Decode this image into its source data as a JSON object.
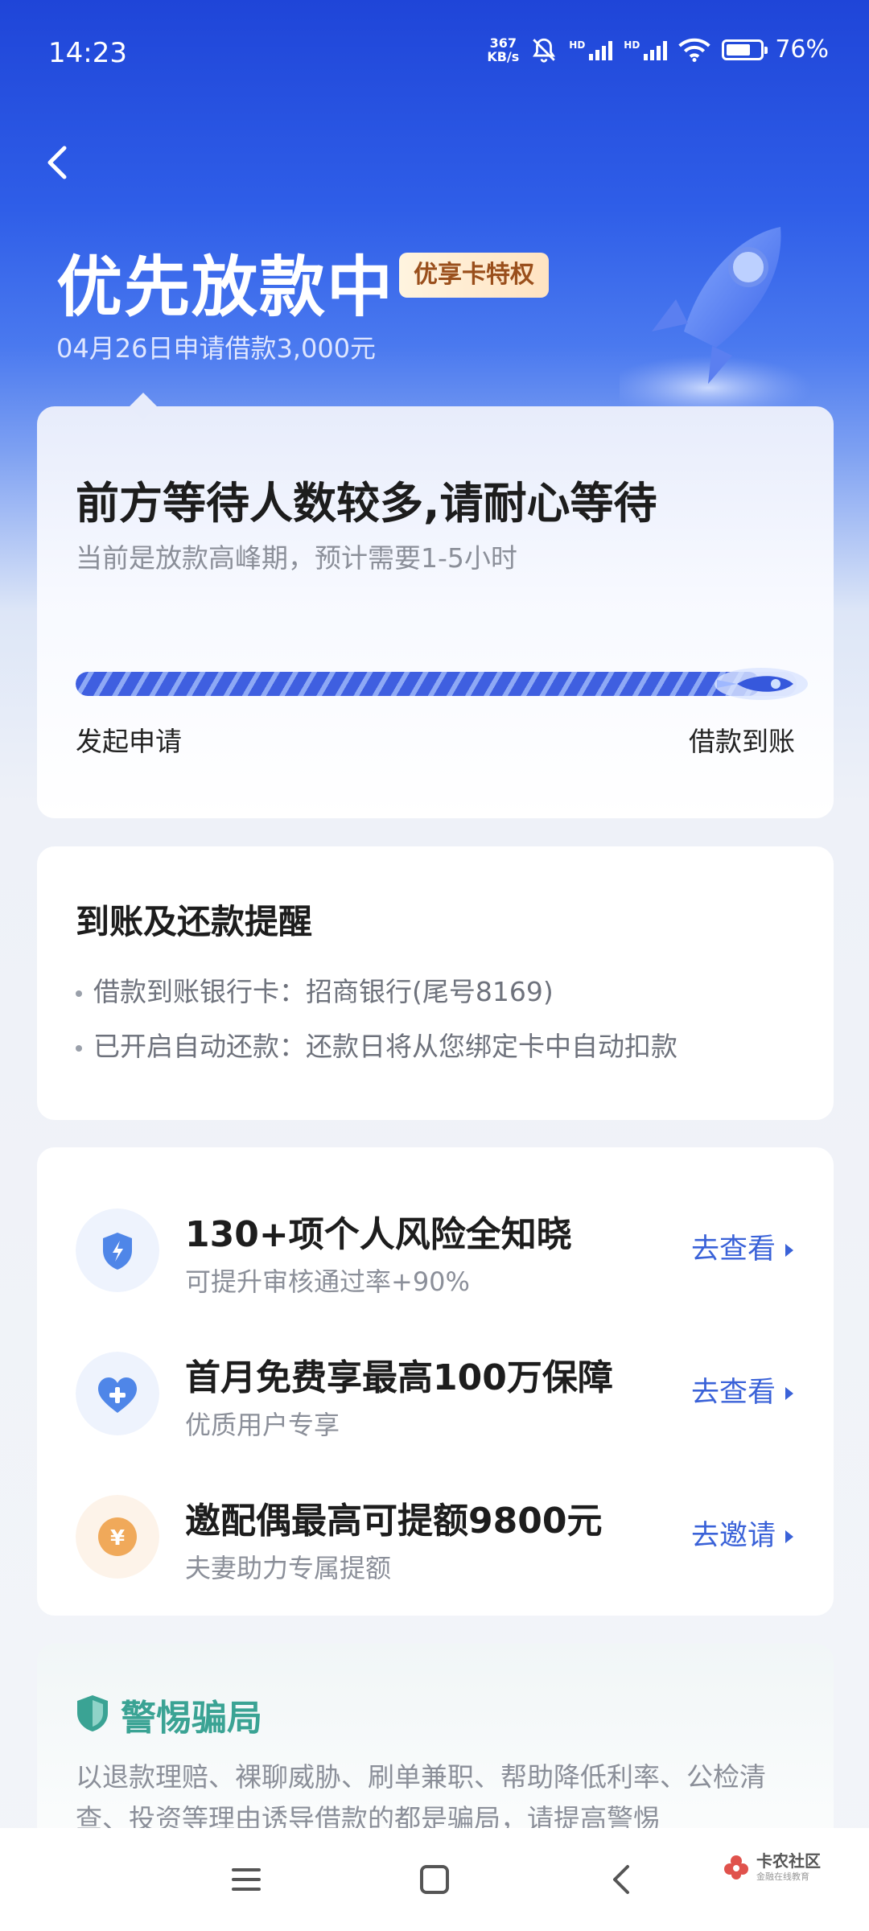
{
  "status_bar": {
    "time": "14:23",
    "net_speed_value": "367",
    "net_speed_unit": "KB/s",
    "battery": "76%",
    "battery_level": 0.76,
    "hd_label": "HD"
  },
  "header": {
    "title": "优先放款中",
    "badge": "优享卡特权",
    "subtitle": "04月26日申请借款3,000元"
  },
  "progress_card": {
    "title": "前方等待人数较多,请耐心等待",
    "subtitle": "当前是放款高峰期，预计需要1-5小时",
    "progress_fraction": 0.95,
    "start_label": "发起申请",
    "end_label": "借款到账"
  },
  "reminder_card": {
    "title": "到账及还款提醒",
    "lines": [
      "借款到账银行卡：招商银行(尾号8169)",
      "已开启自动还款：还款日将从您绑定卡中自动扣款"
    ]
  },
  "services": [
    {
      "title": "130+项个人风险全知晓",
      "desc": "可提升审核通过率+90%",
      "action": "去查看",
      "icon": "shield-bolt-icon",
      "color": "#4f86e8"
    },
    {
      "title": "首月免费享最高100万保障",
      "desc": "优质用户专享",
      "action": "去查看",
      "icon": "heart-plus-icon",
      "color": "#4f86e8"
    },
    {
      "title": "邀配偶最高可提额9800元",
      "desc": "夫妻助力专属提额",
      "action": "去邀请",
      "icon": "yuan-coin-icon",
      "color": "#f0a95a"
    }
  ],
  "fraud_card": {
    "title": "警惕骗局",
    "text": "以退款理赔、裸聊威胁、刷单兼职、帮助降低利率、公检清查、投资等理由诱导借款的都是骗局，请提高警惕"
  },
  "watermark": {
    "name": "卡农社区",
    "sub": "金融在线教育"
  },
  "colors": {
    "primary": "#2f5ee8",
    "link": "#3a62d8",
    "safe_green": "#3aa394"
  }
}
